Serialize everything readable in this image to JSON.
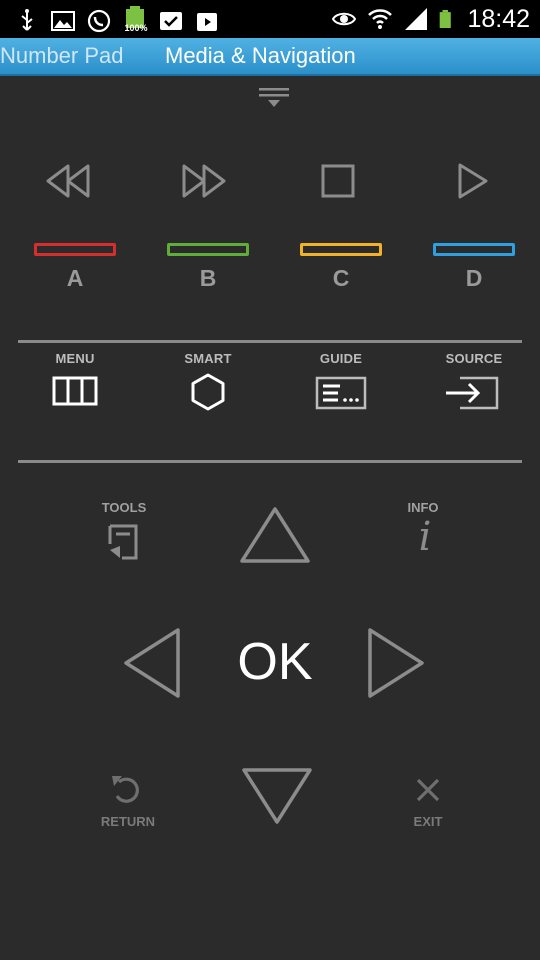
{
  "status_bar": {
    "left_icons": [
      "usb-icon",
      "gallery-icon",
      "whatsapp-icon",
      "battery-full-icon",
      "task-check-icon",
      "play-store-icon"
    ],
    "battery_small_label": "100%",
    "right_icons": [
      "eye-icon",
      "wifi-icon",
      "signal-icon",
      "battery-icon"
    ],
    "time": "18:42"
  },
  "tabs": [
    {
      "label": "Number Pad",
      "active": false
    },
    {
      "label": "Media & Navigation",
      "active": true
    }
  ],
  "media_controls": [
    {
      "name": "rewind",
      "icon": "rewind-icon"
    },
    {
      "name": "fast-forward",
      "icon": "fast-forward-icon"
    },
    {
      "name": "stop",
      "icon": "stop-icon"
    },
    {
      "name": "play",
      "icon": "play-icon"
    }
  ],
  "color_buttons": [
    {
      "label": "A",
      "color": "#d32f2f"
    },
    {
      "label": "B",
      "color": "#5fae3a"
    },
    {
      "label": "C",
      "color": "#f2b228"
    },
    {
      "label": "D",
      "color": "#2f9fe0"
    }
  ],
  "functions": [
    {
      "label": "MENU",
      "icon": "menu-grid-icon"
    },
    {
      "label": "SMART",
      "icon": "hexagon-icon"
    },
    {
      "label": "GUIDE",
      "icon": "guide-list-icon"
    },
    {
      "label": "SOURCE",
      "icon": "source-input-icon"
    }
  ],
  "nav": {
    "tools_label": "TOOLS",
    "info_label": "INFO",
    "ok_label": "OK",
    "return_label": "RETURN",
    "exit_label": "EXIT",
    "info_glyph": "i"
  },
  "colors": {
    "background": "#2b2b2b",
    "tab_accent": "#3aa0d6",
    "icon_gray": "#8c8c8c"
  }
}
